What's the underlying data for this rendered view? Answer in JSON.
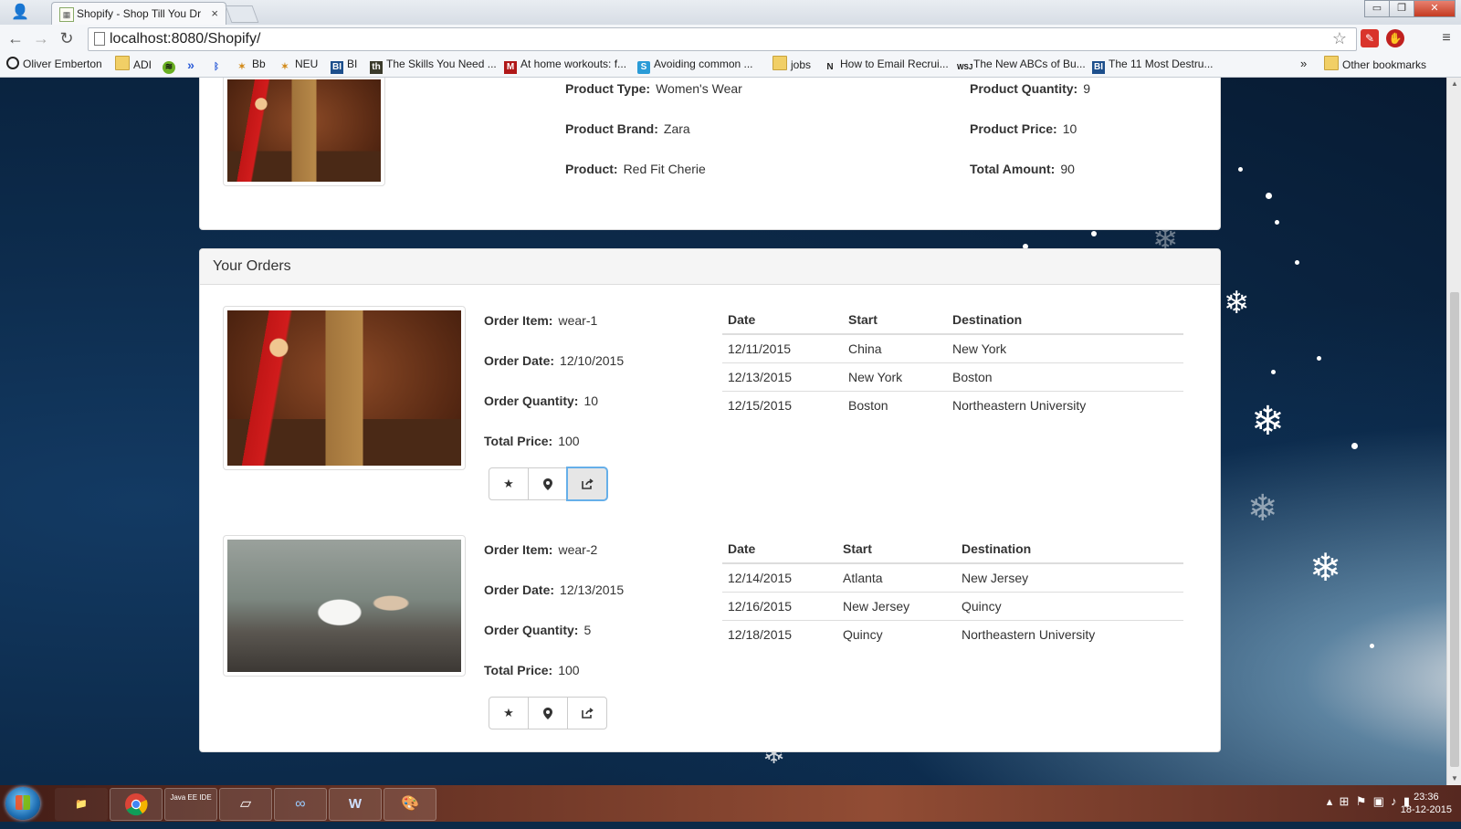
{
  "browser": {
    "tab_title": "Shopify - Shop Till You Dr",
    "tab_close": "×",
    "url": "localhost:8080/Shopify/",
    "window_controls": [
      "▭",
      "❐",
      "✕"
    ]
  },
  "bookmarks": [
    {
      "label": "Oliver Emberton",
      "icon": "circle-icon"
    },
    {
      "label": "ADI",
      "icon": "folder-icon"
    },
    {
      "label": "",
      "icon": "spotify-icon"
    },
    {
      "label": "",
      "icon": "double-chevron-icon"
    },
    {
      "label": "",
      "icon": "bluetooth-icon"
    },
    {
      "label": "Bb",
      "icon": "blackboard-icon"
    },
    {
      "label": "NEU",
      "icon": "neu-icon"
    },
    {
      "label": "BI",
      "icon": "bi-icon"
    },
    {
      "label": "The Skills You Need ...",
      "icon": "th-icon"
    },
    {
      "label": "At home workouts: f...",
      "icon": "fitness-icon"
    },
    {
      "label": "Avoiding common ...",
      "icon": "s-icon"
    },
    {
      "label": "jobs",
      "icon": "folder-icon"
    },
    {
      "label": "How to Email Recrui...",
      "icon": "n-icon"
    },
    {
      "label": "The New ABCs of Bu...",
      "icon": "wsj-icon"
    },
    {
      "label": "The 11 Most Destru...",
      "icon": "bi-icon"
    }
  ],
  "bookmarks_overflow": "»",
  "other_bookmarks": "Other bookmarks",
  "current_product": {
    "type_label": "Product Type:",
    "type": "Women's Wear",
    "brand_label": "Product Brand:",
    "brand": "Zara",
    "product_label": "Product:",
    "product": "Red Fit Cherie",
    "quantity_label": "Product Quantity:",
    "quantity": "9",
    "price_label": "Product Price:",
    "price": "10",
    "total_label": "Total Amount:",
    "total": "90"
  },
  "orders_panel": {
    "heading": "Your Orders",
    "labels": {
      "item": "Order Item:",
      "date": "Order Date:",
      "quantity": "Order Quantity:",
      "price": "Total Price:"
    },
    "route_headers": [
      "Date",
      "Start",
      "Destination"
    ],
    "orders": [
      {
        "item": "wear-1",
        "date": "12/10/2015",
        "quantity": "10",
        "price": "100",
        "routes": [
          {
            "date": "12/11/2015",
            "start": "China",
            "destination": "New York"
          },
          {
            "date": "12/13/2015",
            "start": "New York",
            "destination": "Boston"
          },
          {
            "date": "12/15/2015",
            "start": "Boston",
            "destination": "Northeastern University"
          }
        ]
      },
      {
        "item": "wear-2",
        "date": "12/13/2015",
        "quantity": "5",
        "price": "100",
        "routes": [
          {
            "date": "12/14/2015",
            "start": "Atlanta",
            "destination": "New Jersey"
          },
          {
            "date": "12/16/2015",
            "start": "New Jersey",
            "destination": "Quincy"
          },
          {
            "date": "12/18/2015",
            "start": "Quincy",
            "destination": "Northeastern University"
          }
        ]
      }
    ],
    "action_icons": [
      "star-icon",
      "map-marker-icon",
      "share-icon"
    ]
  },
  "taskbar": {
    "apps": [
      "file-explorer-icon",
      "chrome-icon",
      "java-ee-ide-icon",
      "notepad-icon",
      "visual-studio-icon",
      "word-icon",
      "paint-icon"
    ],
    "java_label": "Java EE IDE",
    "time": "23:36",
    "date": "18-12-2015"
  },
  "colors": {
    "panel_border": "#dddddd",
    "active_button_border": "#66afe9",
    "background": "#0b2a48"
  }
}
